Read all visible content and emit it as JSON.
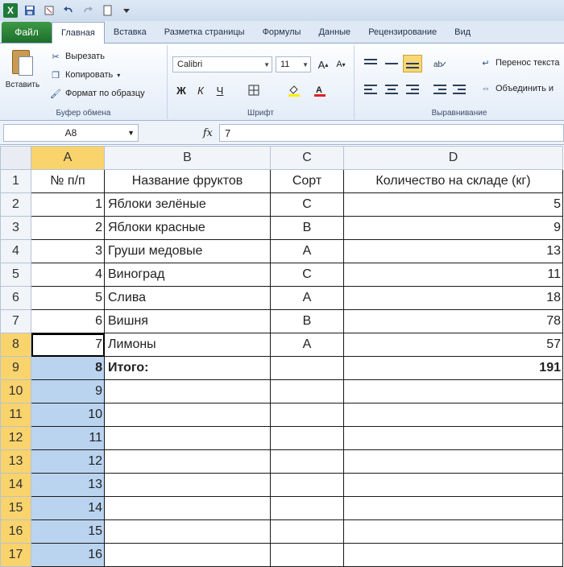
{
  "app": {
    "logo_letter": "X"
  },
  "tabs": [
    {
      "label": "Файл"
    },
    {
      "label": "Главная"
    },
    {
      "label": "Вставка"
    },
    {
      "label": "Разметка страницы"
    },
    {
      "label": "Формулы"
    },
    {
      "label": "Данные"
    },
    {
      "label": "Рецензирование"
    },
    {
      "label": "Вид"
    }
  ],
  "ribbon": {
    "clipboard": {
      "paste_label": "Вставить",
      "cut_label": "Вырезать",
      "copy_label": "Копировать",
      "format_painter_label": "Формат по образцу",
      "group_label": "Буфер обмена"
    },
    "font": {
      "font_name": "Calibri",
      "font_size": "11",
      "bold": "Ж",
      "italic": "К",
      "underline": "Ч",
      "group_label": "Шрифт"
    },
    "alignment": {
      "wrap_label": "Перенос текста",
      "merge_label": "Объединить и",
      "group_label": "Выравнивание"
    }
  },
  "formula_bar": {
    "name_box": "A8",
    "fx": "fx",
    "value": "7"
  },
  "sheet": {
    "columns": [
      "A",
      "B",
      "C",
      "D"
    ],
    "header_row": {
      "num": "№ п/п",
      "name": "Название фруктов",
      "grade": "Сорт",
      "qty": "Количество на складе (кг)"
    },
    "rows": [
      {
        "row": "2",
        "num": "1",
        "name": "Яблоки зелёные",
        "grade": "С",
        "qty": "5"
      },
      {
        "row": "3",
        "num": "2",
        "name": "Яблоки красные",
        "grade": "В",
        "qty": "9"
      },
      {
        "row": "4",
        "num": "3",
        "name": "Груши медовые",
        "grade": "А",
        "qty": "13"
      },
      {
        "row": "5",
        "num": "4",
        "name": "Виноград",
        "grade": "С",
        "qty": "11"
      },
      {
        "row": "6",
        "num": "5",
        "name": "Слива",
        "grade": "А",
        "qty": "18"
      },
      {
        "row": "7",
        "num": "6",
        "name": "Вишня",
        "grade": "В",
        "qty": "78"
      },
      {
        "row": "8",
        "num": "7",
        "name": "Лимоны",
        "grade": "А",
        "qty": "57"
      }
    ],
    "total_row": {
      "row": "9",
      "num": "8",
      "label": "Итого:",
      "qty": "191"
    },
    "extra_rows": [
      {
        "row": "10",
        "num": "9"
      },
      {
        "row": "11",
        "num": "10"
      },
      {
        "row": "12",
        "num": "11"
      },
      {
        "row": "13",
        "num": "12"
      },
      {
        "row": "14",
        "num": "13"
      },
      {
        "row": "15",
        "num": "14"
      },
      {
        "row": "16",
        "num": "15"
      },
      {
        "row": "17",
        "num": "16"
      }
    ]
  }
}
